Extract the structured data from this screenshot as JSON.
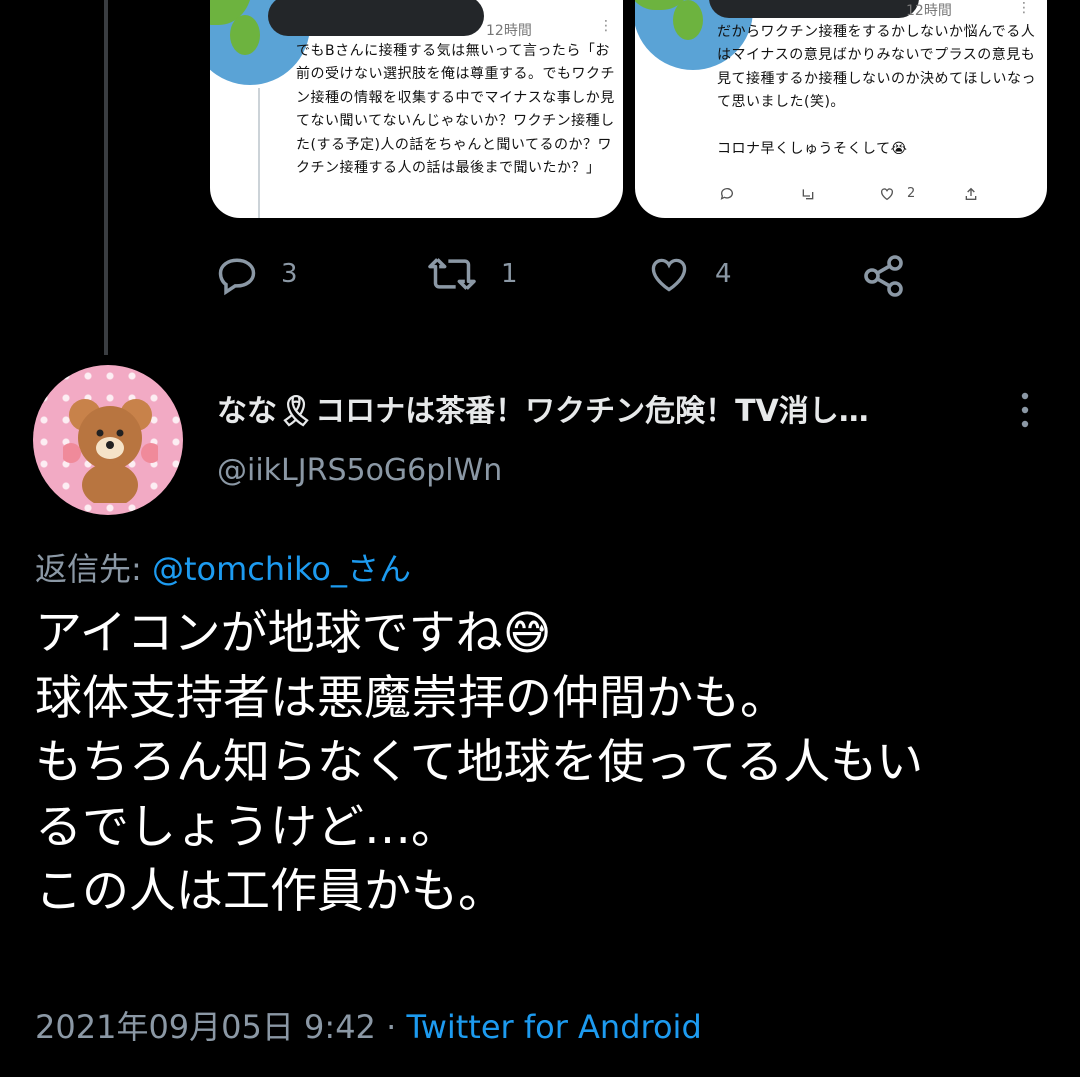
{
  "embedded_images": {
    "left": {
      "time": "12時間",
      "text": "でもBさんに接種する気は無いって言ったら「お前の受けない選択肢を俺は尊重する。でもワクチン接種の情報を収集する中でマイナスな事しか見てない聞いてないんじゃないか？ワクチン接種した(する予定)人の話をちゃんと聞いてるのか？ワクチン接種する人の話は最後まで聞いたか？」"
    },
    "right": {
      "time": "12時間",
      "text": "だからワクチン接種をするかしないか悩んでる人はマイナスの意見ばかりみないでプラスの意見も見て接種するか接種しないのか決めてほしいなって思いました(笑)。\n\nコロナ早くしゅうそくして😭",
      "like_count": "2"
    }
  },
  "actions": {
    "reply_count": "3",
    "retweet_count": "1",
    "like_count": "4"
  },
  "author": {
    "name": "なな🎗コロナは茶番！ワクチン危険！TV消し…",
    "handle": "@iikLJRS5oG6plWn"
  },
  "reply_to": {
    "prefix": "返信先: ",
    "mention": "@tomchiko_さん"
  },
  "tweet": {
    "lines": [
      "アイコンが地球ですね😅",
      "球体支持者は悪魔崇拝の仲間かも。",
      "もちろん知らなくて地球を使ってる人もい",
      "るでしょうけど…。",
      "この人は工作員かも。"
    ]
  },
  "meta": {
    "datetime": "2021年09月05日 9:42",
    "separator": " · ",
    "source": "Twitter for Android"
  },
  "colors": {
    "background": "#000000",
    "text": "#e7e9ea",
    "muted": "#8b98a5",
    "link": "#1d9bf0"
  }
}
